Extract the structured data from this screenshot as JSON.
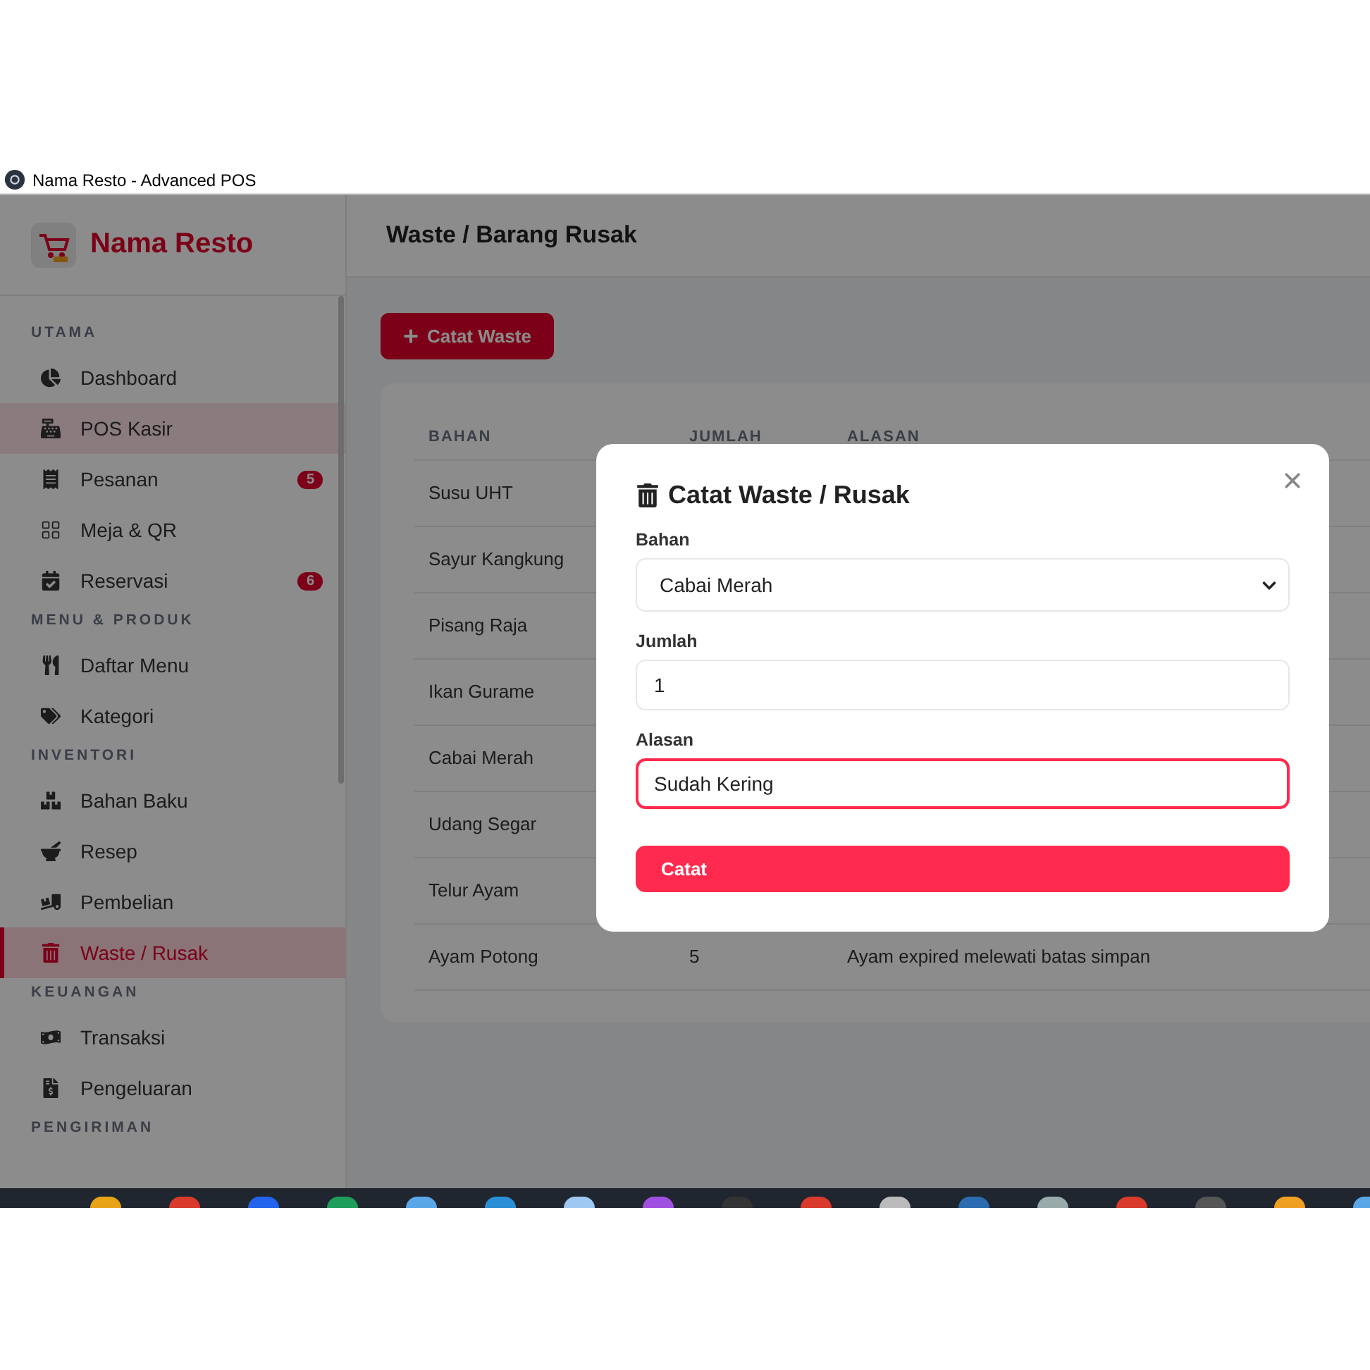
{
  "window": {
    "title": "Nama Resto - Advanced POS"
  },
  "brand": {
    "name": "Nama Resto"
  },
  "sidebar": {
    "sections": [
      {
        "label": "UTAMA",
        "items": [
          {
            "label": "Dashboard",
            "selected": false,
            "hovered": false
          },
          {
            "label": "POS Kasir",
            "selected": false,
            "hovered": true
          },
          {
            "label": "Pesanan",
            "selected": false,
            "hovered": false,
            "badge": "5"
          },
          {
            "label": "Meja & QR",
            "selected": false,
            "hovered": false
          },
          {
            "label": "Reservasi",
            "selected": false,
            "hovered": false,
            "badge": "6"
          }
        ]
      },
      {
        "label": "MENU & PRODUK",
        "items": [
          {
            "label": "Daftar Menu",
            "selected": false,
            "hovered": false
          },
          {
            "label": "Kategori",
            "selected": false,
            "hovered": false
          }
        ]
      },
      {
        "label": "INVENTORI",
        "items": [
          {
            "label": "Bahan Baku",
            "selected": false,
            "hovered": false
          },
          {
            "label": "Resep",
            "selected": false,
            "hovered": false
          },
          {
            "label": "Pembelian",
            "selected": false,
            "hovered": false
          },
          {
            "label": "Waste / Rusak",
            "selected": true,
            "hovered": false
          }
        ]
      },
      {
        "label": "KEUANGAN",
        "items": [
          {
            "label": "Transaksi",
            "selected": false,
            "hovered": false
          },
          {
            "label": "Pengeluaran",
            "selected": false,
            "hovered": false
          }
        ]
      },
      {
        "label": "PENGIRIMAN"
      }
    ]
  },
  "page": {
    "title": "Waste / Barang Rusak",
    "add_button": "Catat Waste"
  },
  "table": {
    "columns": [
      "BAHAN",
      "JUMLAH",
      "ALASAN"
    ],
    "rows": [
      {
        "bahan": "Susu UHT"
      },
      {
        "bahan": "Sayur Kangkung"
      },
      {
        "bahan": "Pisang Raja"
      },
      {
        "bahan": "Ikan Gurame"
      },
      {
        "bahan": "Cabai Merah"
      },
      {
        "bahan": "Udang Segar"
      },
      {
        "bahan": "Telur Ayam"
      },
      {
        "bahan": "Ayam Potong",
        "jumlah": "5",
        "alasan": "Ayam expired melewati batas simpan"
      }
    ]
  },
  "modal": {
    "title": "Catat Waste / Rusak",
    "fields": [
      {
        "kind": "select",
        "label": "Bahan",
        "value": "Cabai Merah",
        "focused": false
      },
      {
        "kind": "input",
        "label": "Jumlah",
        "value": "1",
        "focused": false
      },
      {
        "kind": "input",
        "label": "Alasan",
        "value": "Sudah Kering",
        "focused": true
      }
    ],
    "submit": "Catat"
  }
}
